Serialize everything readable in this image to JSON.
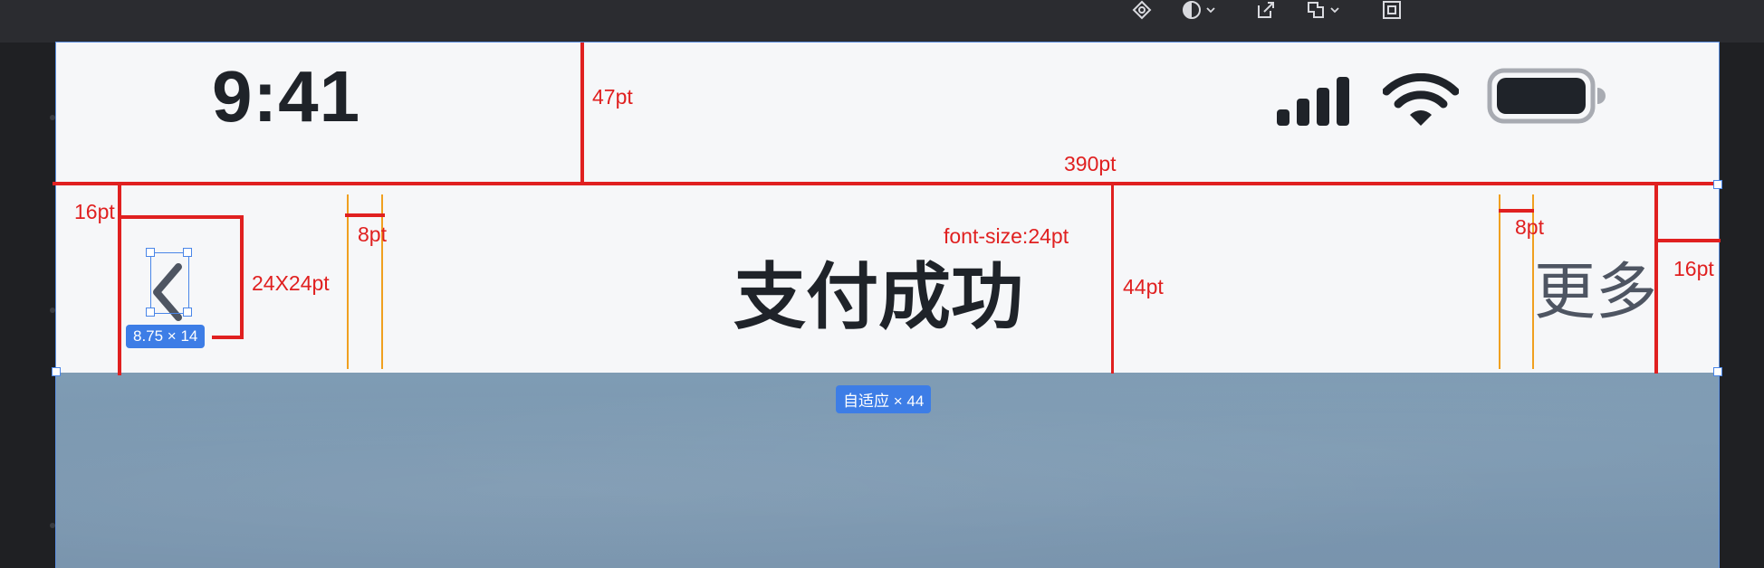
{
  "editor": {
    "toolbar_icons": [
      "component-icon",
      "contrast-icon",
      "export-icon",
      "boolean-icon",
      "frame-icon"
    ]
  },
  "status_bar": {
    "time": "9:41",
    "icons": [
      "cellular-signal-icon",
      "wifi-icon",
      "battery-icon"
    ]
  },
  "nav_bar": {
    "title": "支付成功",
    "more": "更多",
    "back_icon": "chevron-left-icon"
  },
  "annotations": {
    "status_height": "47pt",
    "screen_width": "390pt",
    "left_padding": "16pt",
    "back_size": "24X24pt",
    "left_gap": "8pt",
    "title_font": "font-size:24pt",
    "nav_height": "44pt",
    "right_gap": "8pt",
    "right_padding": "16pt",
    "back_selection_size": "8.75 × 14",
    "nav_selection_size": "自适应 × 44"
  },
  "colors": {
    "annotation": "#e02020",
    "selection": "#3d7de6",
    "text": "#1f2329"
  }
}
